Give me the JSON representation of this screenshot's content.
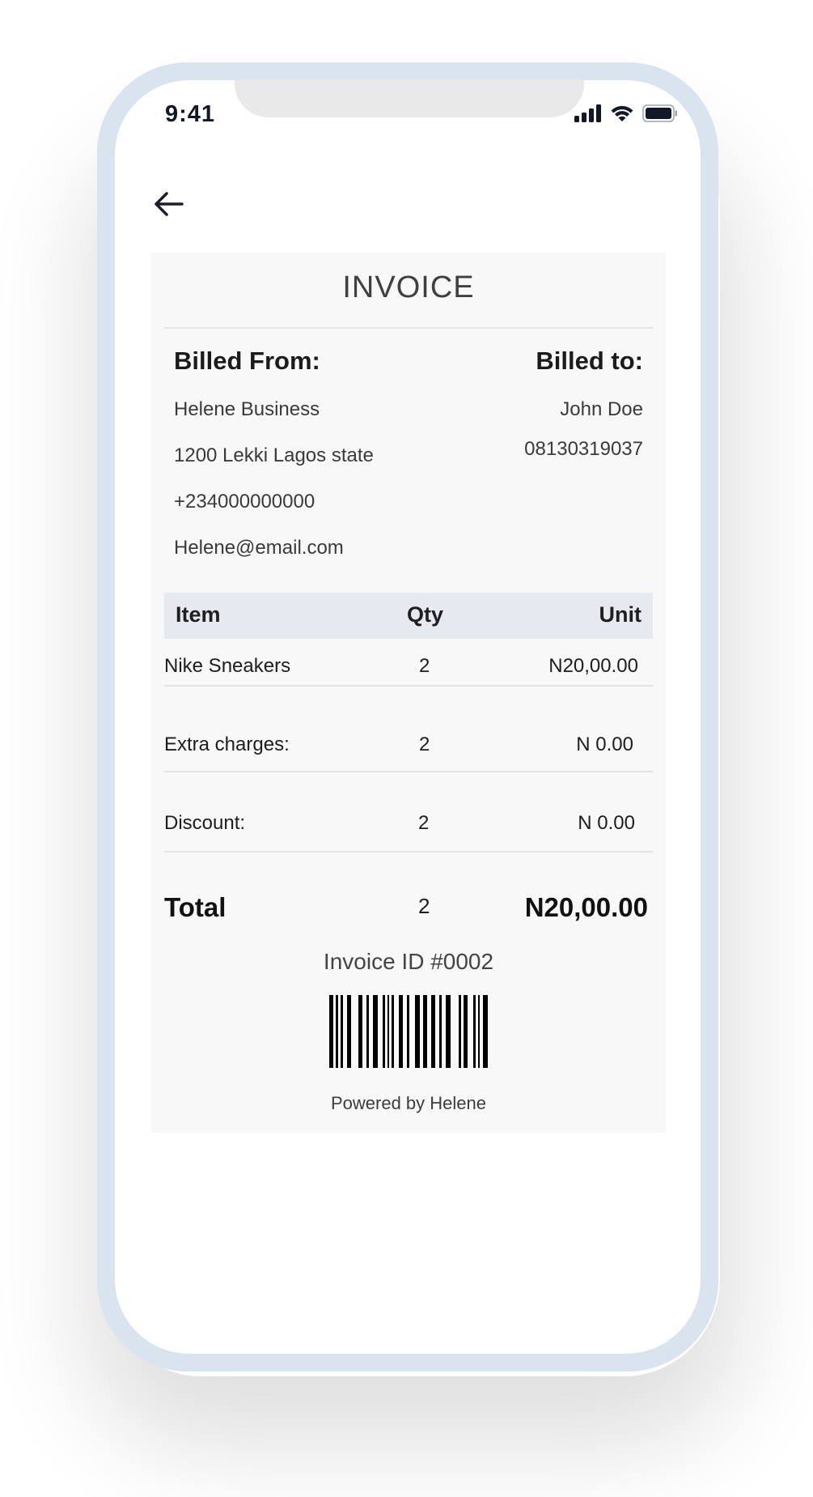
{
  "status_bar": {
    "time": "9:41",
    "icons": [
      "signal-icon",
      "wifi-icon",
      "battery-icon"
    ]
  },
  "nav": {
    "back_icon": "arrow-left-icon"
  },
  "invoice": {
    "title": "INVOICE",
    "billed_from": {
      "heading": "Billed From:",
      "name": "Helene Business",
      "address": "1200 Lekki Lagos state",
      "phone": "+234000000000",
      "email": "Helene@email.com"
    },
    "billed_to": {
      "heading": "Billed to:",
      "name": "John Doe",
      "phone": "08130319037"
    },
    "table": {
      "headers": [
        "Item",
        "Qty",
        "Unit"
      ],
      "rows": [
        {
          "item": "Nike Sneakers",
          "qty": "2",
          "unit": "N20,00.00"
        },
        {
          "item": "Extra charges:",
          "qty": "2",
          "unit": "N 0.00"
        },
        {
          "item": "Discount:",
          "qty": "2",
          "unit": "N 0.00"
        }
      ]
    },
    "total": {
      "label": "Total",
      "qty": "2",
      "amount": "N20,00.00"
    },
    "invoice_id": "Invoice ID #0002",
    "powered_by": "Powered by Helene"
  },
  "colors": {
    "phone_frame": "#d9e4ef",
    "card_background": "#f8f8f8",
    "table_header": "#e6e9f0",
    "text_dark": "#1b1b1b"
  }
}
